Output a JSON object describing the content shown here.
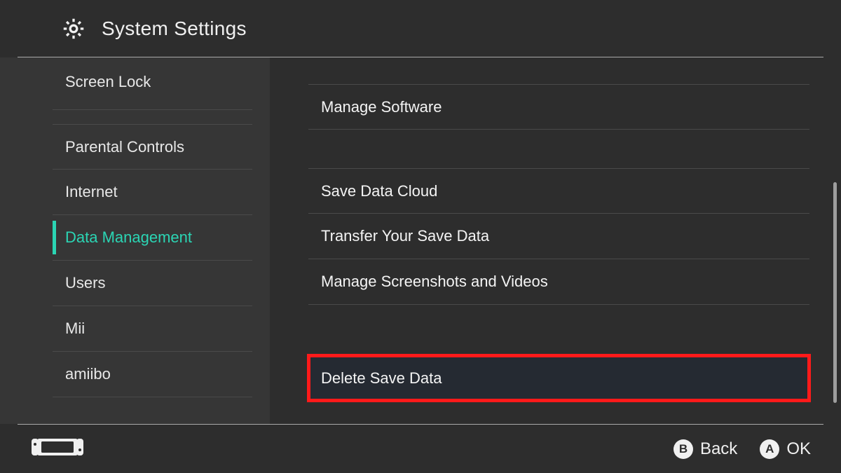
{
  "header": {
    "title": "System Settings"
  },
  "sidebar": {
    "items": [
      {
        "label": "Screen Lock"
      },
      {
        "label": "Parental Controls"
      },
      {
        "label": "Internet"
      },
      {
        "label": "Data Management"
      },
      {
        "label": "Users"
      },
      {
        "label": "Mii"
      },
      {
        "label": "amiibo"
      }
    ],
    "selected_index": 3
  },
  "main": {
    "group1": [
      {
        "label": "Manage Software"
      }
    ],
    "group2": [
      {
        "label": "Save Data Cloud"
      },
      {
        "label": "Transfer Your Save Data"
      },
      {
        "label": "Manage Screenshots and Videos"
      }
    ],
    "group3": [
      {
        "label": "Delete Save Data"
      }
    ]
  },
  "footer": {
    "back": {
      "glyph": "B",
      "label": "Back"
    },
    "ok": {
      "glyph": "A",
      "label": "OK"
    }
  },
  "colors": {
    "accent": "#2bd5b4",
    "highlight": "#ff1a1a"
  }
}
